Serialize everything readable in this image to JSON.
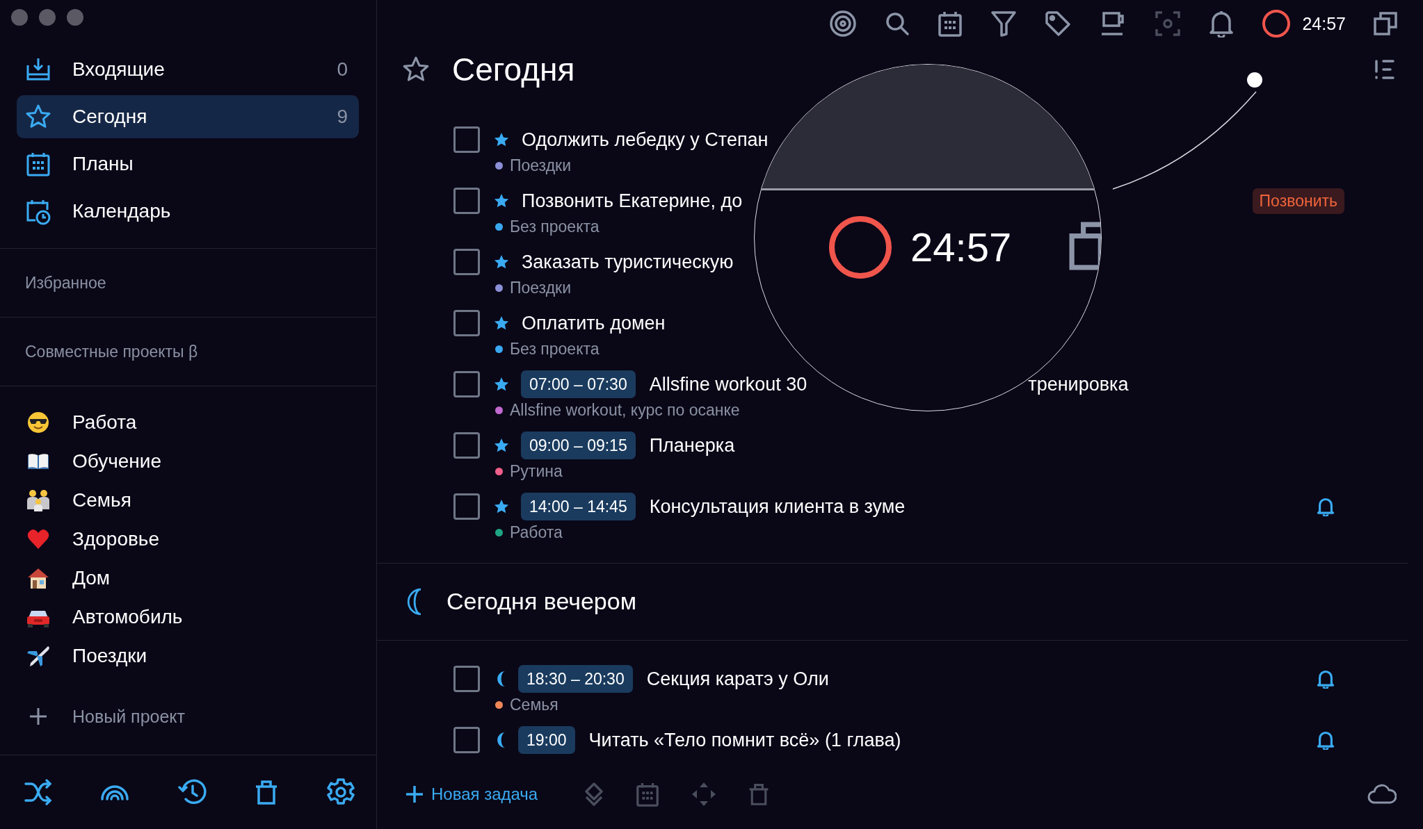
{
  "sidebar": {
    "nav": [
      {
        "label": "Входящие",
        "count": "0",
        "selected": false
      },
      {
        "label": "Сегодня",
        "count": "9",
        "selected": true
      },
      {
        "label": "Планы",
        "selected": false
      },
      {
        "label": "Календарь",
        "selected": false
      }
    ],
    "sections": [
      "Избранное",
      "Совместные проекты β"
    ],
    "projects": [
      {
        "label": "Работа"
      },
      {
        "label": "Обучение"
      },
      {
        "label": "Семья"
      },
      {
        "label": "Здоровье"
      },
      {
        "label": "Дом"
      },
      {
        "label": "Автомобиль"
      },
      {
        "label": "Поездки"
      }
    ],
    "new_project": "Новый проект"
  },
  "toolbar": {
    "timer": "24:57"
  },
  "header": {
    "title": "Сегодня"
  },
  "tasks": [
    {
      "title": "Одолжить лебедку у Степан",
      "project": "Поездки",
      "color": "#8b8fd6",
      "checked": false,
      "reminder": false
    },
    {
      "title": "Позвонить Екатерине, до",
      "project": "Без проекта",
      "color": "#3aa8f0",
      "tag": "Позвонить",
      "checked": false,
      "reminder": false
    },
    {
      "title": "Заказать туристическую",
      "project": "Поездки",
      "color": "#8b8fd6",
      "checked": false,
      "reminder": false
    },
    {
      "title": "Оплатить домен",
      "project": "Без проекта",
      "color": "#3aa8f0",
      "checked": false,
      "reminder": false
    },
    {
      "time": "07:00 – 07:30",
      "title": "Allsfine workout 30",
      "tail": "тренировка",
      "project": "Allsfine workout, курс по осанке",
      "color": "#c06ad0",
      "checked": false,
      "reminder": false
    },
    {
      "time": "09:00 – 09:15",
      "title": "Планерка",
      "project": "Рутина",
      "color": "#f0608a",
      "checked": false,
      "reminder": false
    },
    {
      "time": "14:00 – 14:45",
      "title": "Консультация клиента в зуме",
      "project": "Работа",
      "color": "#1fa584",
      "checked": false,
      "reminder": true
    }
  ],
  "evening": {
    "title": "Сегодня вечером",
    "tasks": [
      {
        "time": "18:30 – 20:30",
        "title": "Секция каратэ у Оли",
        "project": "Семья",
        "color": "#f08658",
        "checked": false,
        "reminder": true
      },
      {
        "time": "19:00",
        "title": "Читать «Тело помнит всё» (1 глава)",
        "checked": false,
        "reminder": true
      }
    ]
  },
  "new_task": "Новая задача",
  "magnifier": {
    "timer": "24:57"
  }
}
